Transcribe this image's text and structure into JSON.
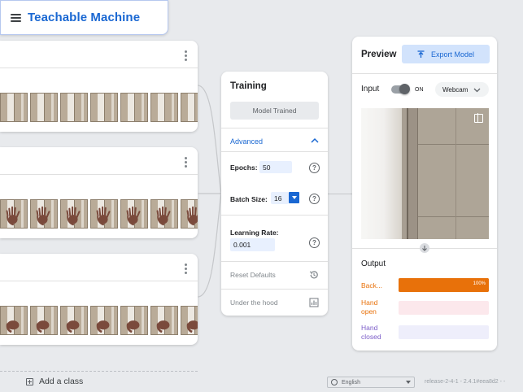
{
  "app": {
    "title": "Teachable Machine"
  },
  "classes": [
    {
      "kind": "door",
      "sample_count": 7
    },
    {
      "kind": "hand_open",
      "sample_count": 7
    },
    {
      "kind": "hand_closed",
      "sample_count": 7
    }
  ],
  "training": {
    "title": "Training",
    "status_button": "Model Trained",
    "advanced_label": "Advanced",
    "epochs_label": "Epochs:",
    "epochs_value": "50",
    "batch_label": "Batch Size:",
    "batch_value": "16",
    "lr_label": "Learning Rate:",
    "lr_value": "0.001",
    "help_glyph": "?",
    "reset_label": "Reset Defaults",
    "hood_label": "Under the hood"
  },
  "preview": {
    "title": "Preview",
    "export_label": "Export Model",
    "input_label": "Input",
    "toggle_label": "ON",
    "source_label": "Webcam",
    "output_label": "Output",
    "outputs": [
      {
        "label": "Back...",
        "value": 100,
        "value_text": "100%",
        "color": "#e8710a",
        "track": "#e8710a"
      },
      {
        "label": "Hand open",
        "value": 0,
        "value_text": "",
        "color": "#e8710a",
        "track": "#fce8ec"
      },
      {
        "label": "Hand closed",
        "value": 0,
        "value_text": "",
        "color": "#7b5cc8",
        "track": "#eeeefb"
      }
    ]
  },
  "footer": {
    "add_class_label": "Add a class",
    "language": "English",
    "release": "release-2-4-1 - 2.4.1#eea8d2 - -"
  },
  "colors": {
    "brand": "#1967d2",
    "output_1": "#e8710a",
    "output_3": "#7b5cc8"
  }
}
